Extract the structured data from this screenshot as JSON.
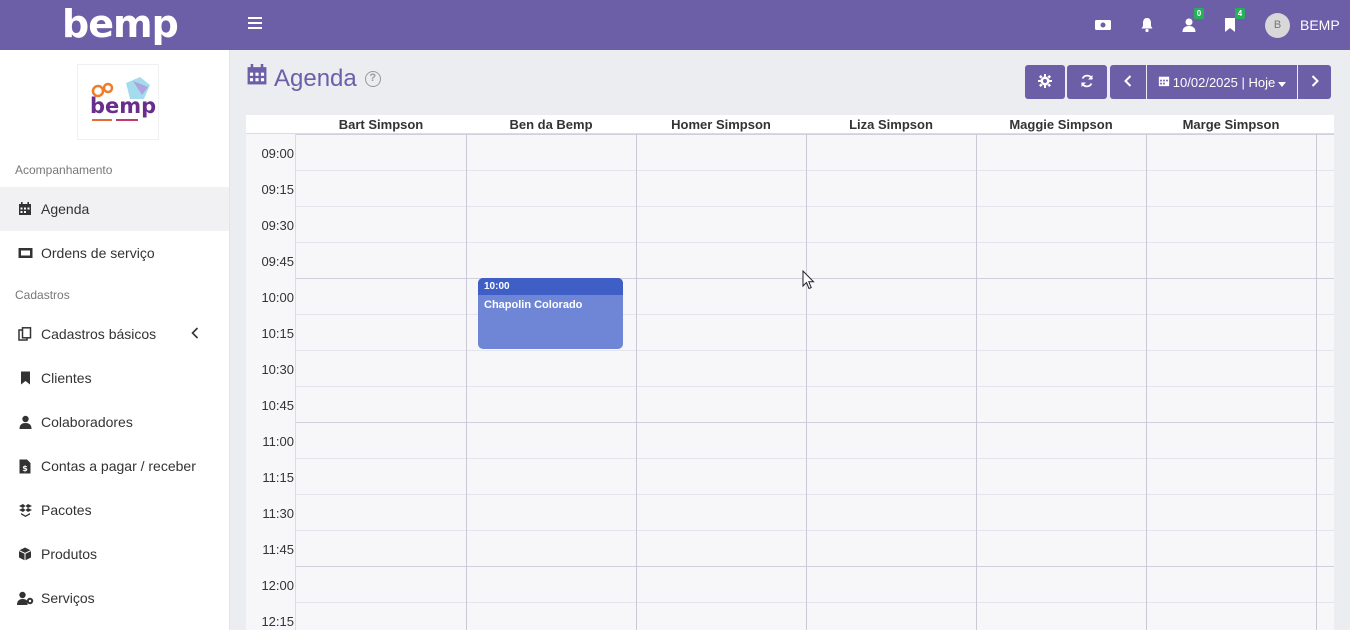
{
  "topbar": {
    "brand": "bemp",
    "badge_users": "0",
    "badge_bookmarks": "4",
    "avatar_initial": "B",
    "username": "BEMP"
  },
  "sidebar": {
    "section_1": "Acompanhamento",
    "section_2": "Cadastros",
    "items": [
      {
        "label": "Agenda",
        "icon": "calendar-icon"
      },
      {
        "label": "Ordens de serviço",
        "icon": "ticket-icon"
      },
      {
        "label": "Cadastros básicos",
        "icon": "copy-icon"
      },
      {
        "label": "Clientes",
        "icon": "bookmark-icon"
      },
      {
        "label": "Colaboradores",
        "icon": "user-icon"
      },
      {
        "label": "Contas a pagar / receber",
        "icon": "money-file-icon"
      },
      {
        "label": "Pacotes",
        "icon": "boxes-icon"
      },
      {
        "label": "Produtos",
        "icon": "cube-icon"
      },
      {
        "label": "Serviços",
        "icon": "user-gear-icon"
      }
    ]
  },
  "page": {
    "title": "Agenda",
    "help": "?",
    "date_label": "10/02/2025 | Hoje"
  },
  "calendar": {
    "columns": [
      "Bart Simpson",
      "Ben da Bemp",
      "Homer Simpson",
      "Liza Simpson",
      "Maggie Simpson",
      "Marge Simpson"
    ],
    "times": [
      "09:00",
      "09:15",
      "09:30",
      "09:45",
      "10:00",
      "10:15",
      "10:30",
      "10:45",
      "11:00",
      "11:15",
      "11:30",
      "11:45",
      "12:00",
      "12:15"
    ],
    "event": {
      "time": "10:00",
      "title": "Chapolin Colorado"
    }
  },
  "colors": {
    "primary": "#6d5ea8",
    "event": "#6f86d6",
    "event_header": "#3f5fc6",
    "badge": "#25b15a"
  }
}
